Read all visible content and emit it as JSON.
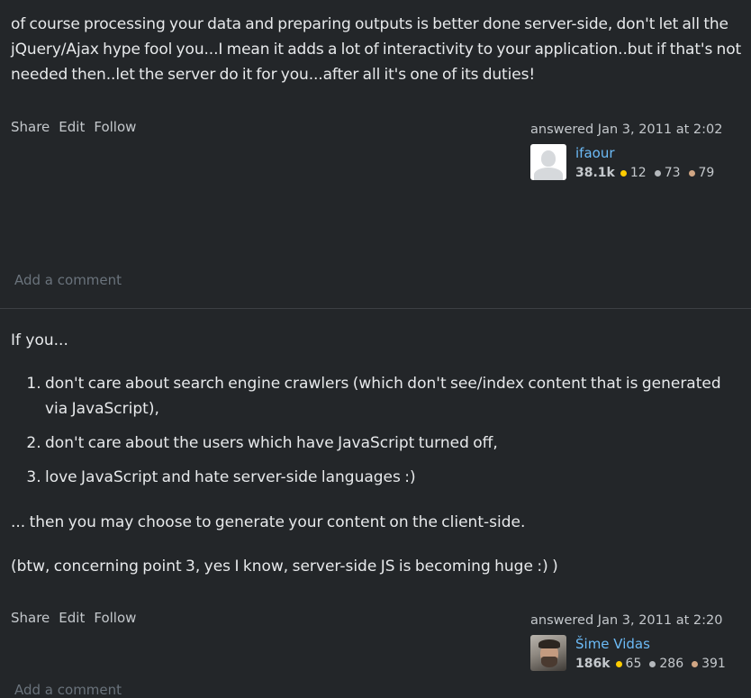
{
  "answers": [
    {
      "body": "of course processing your data and preparing outputs is better done server-side, don't let all the jQuery/Ajax hype fool you...I mean it adds a lot of interactivity to your application..but if that's not needed then..let the server do it for you...after all it's one of its duties!",
      "menu": {
        "share": "Share",
        "edit": "Edit",
        "follow": "Follow"
      },
      "answered": "answered Jan 3, 2011 at 2:02",
      "user": {
        "name": "ifaour",
        "avatar_icon": "default-avatar-icon",
        "reputation": "38.1k",
        "gold": "12",
        "silver": "73",
        "bronze": "79"
      },
      "add_comment": "Add a comment"
    },
    {
      "intro": "If you...",
      "list": [
        "don't care about search engine crawlers (which don't see/index content that is generated via JavaScript),",
        "don't care about the users which have JavaScript turned off,",
        "love JavaScript and hate server-side languages :)"
      ],
      "after1": "... then you may choose to generate your content on the client-side.",
      "after2": "(btw, concerning point 3, yes I know, server-side JS is becoming huge :) )",
      "menu": {
        "share": "Share",
        "edit": "Edit",
        "follow": "Follow"
      },
      "answered": "answered Jan 3, 2011 at 2:20",
      "user": {
        "name": "Šime Vidas",
        "avatar_icon": "user-photo-avatar",
        "reputation": "186k",
        "gold": "65",
        "silver": "286",
        "bronze": "391"
      },
      "add_comment": "Add a comment"
    }
  ],
  "colors": {
    "background": "#232629",
    "text": "#e7e9eb",
    "link": "#6cbbf7",
    "muted": "#6a737c",
    "gold": "#ffcc01",
    "silver": "#b4b8bc",
    "bronze": "#d1a684"
  }
}
